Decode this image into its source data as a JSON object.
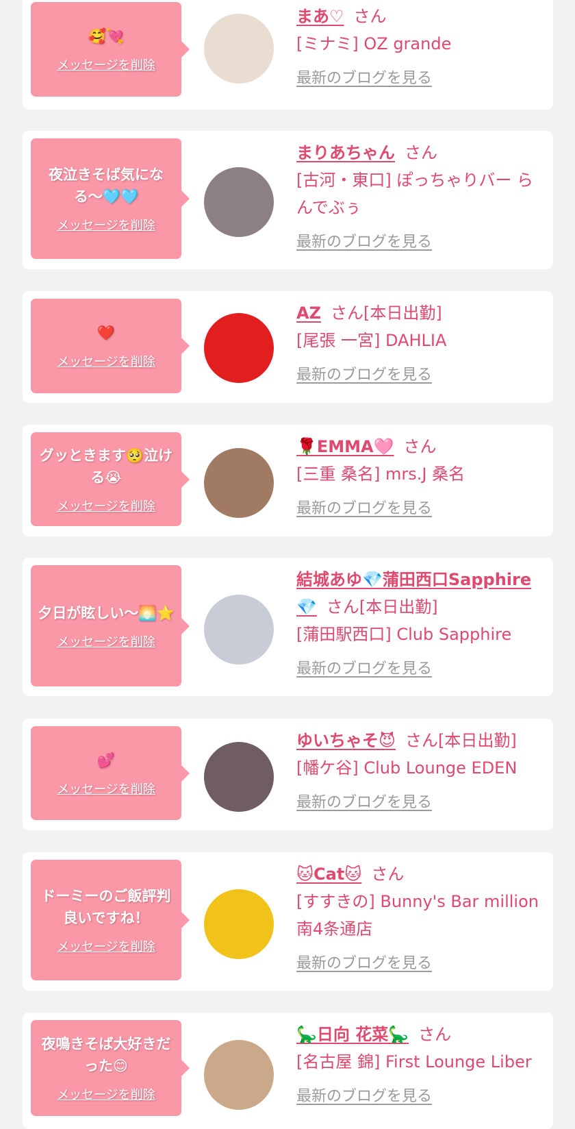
{
  "delete_label": "メッセージを削除",
  "blog_label": "最新のブログを見る",
  "entries": [
    {
      "message": "🥰💘",
      "name": "まあ♡",
      "suffix": "さん",
      "shop": "[ミナミ] OZ grande",
      "avatar_icon": "photo-selfie",
      "avatar_color": "#e9ddd2"
    },
    {
      "message": "夜泣きそば気になる〜🩵🩵",
      "name": "まりあちゃん",
      "suffix": "さん",
      "shop": "[古河・東口] ぽっちゃりバー らんでぶぅ",
      "avatar_icon": "photo-happy",
      "avatar_color": "#8c7f85"
    },
    {
      "message": "❤️",
      "name": "AZ",
      "suffix": "さん[本日出勤]",
      "shop": "[尾張 一宮] DAHLIA",
      "avatar_icon": "photo-red-heart",
      "avatar_color": "#e21e1e"
    },
    {
      "message": "グッときます🥺泣ける😭",
      "name": "🌹EMMA🩷",
      "suffix": "さん",
      "shop": "[三重 桑名] mrs.J 桑名",
      "avatar_icon": "photo-kimono",
      "avatar_color": "#a07a62"
    },
    {
      "message": "夕日が眩しい〜🌅⭐",
      "name": "結城あゆ💎蒲田西口Sapphire💎",
      "suffix": "さん[本日出勤]",
      "shop": "[蒲田駅西口] Club Sapphire",
      "avatar_icon": "photo-balloons",
      "avatar_color": "#c8ccd6"
    },
    {
      "message": "💕",
      "name": "ゆいちゃそ😈",
      "suffix": "さん[本日出勤]",
      "shop": "[幡ケ谷] Club Lounge EDEN",
      "avatar_icon": "photo-love",
      "avatar_color": "#6f5d62"
    },
    {
      "message": "ドーミーのご飯評判良いですね！",
      "name": "🐱Cat🐱",
      "suffix": "さん",
      "shop": "[すすきの] Bunny's Bar million 南4条通店",
      "avatar_icon": "photo-bunny",
      "avatar_color": "#f0c21a"
    },
    {
      "message": "夜鳴きそば大好きだった😊",
      "name": "🦕日向 花菜🦕",
      "suffix": "さん",
      "shop": "[名古屋 錦] First Lounge Liber",
      "avatar_icon": "photo-cap",
      "avatar_color": "#c9a98a"
    }
  ]
}
